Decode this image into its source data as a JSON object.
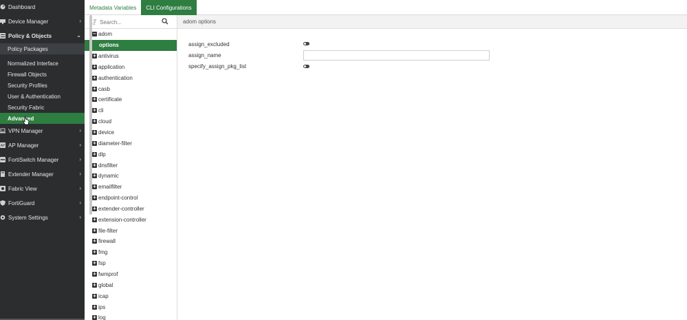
{
  "sidebar": {
    "items": [
      {
        "label": "Dashboard",
        "icon": "dashboard-icon",
        "chevron": false
      },
      {
        "label": "Device Manager",
        "icon": "device-manager-icon",
        "chevron": true
      },
      {
        "label": "Policy & Objects",
        "icon": "policy-objects-icon",
        "chevron": true,
        "expanded": true
      }
    ],
    "sub_items_a": [
      "Policy Packages"
    ],
    "sub_items_b": [
      "Normalized Interface",
      "Firewall Objects",
      "Security Profiles",
      "User & Authentication",
      "Security Fabric",
      "Advanced"
    ],
    "items_after": [
      {
        "label": "VPN Manager",
        "icon": "vpn-manager-icon"
      },
      {
        "label": "AP Manager",
        "icon": "ap-manager-icon"
      },
      {
        "label": "FortiSwitch Manager",
        "icon": "fortiswitch-manager-icon"
      },
      {
        "label": "Extender Manager",
        "icon": "extender-manager-icon"
      },
      {
        "label": "Fabric View",
        "icon": "fabric-view-icon"
      },
      {
        "label": "FortiGuard",
        "icon": "fortiguard-icon"
      },
      {
        "label": "System Settings",
        "icon": "system-settings-icon"
      }
    ]
  },
  "tabs": [
    {
      "label": "Metadata Variables",
      "active": false
    },
    {
      "label": "CLI Configurations",
      "active": true
    }
  ],
  "tree": {
    "search_placeholder": "Search...",
    "root": "adom",
    "selected": "options",
    "nodes": [
      "antivirus",
      "application",
      "authentication",
      "casb",
      "certificate",
      "cli",
      "cloud",
      "device",
      "diameter-filter",
      "dlp",
      "dnsfilter",
      "dynamic",
      "emailfilter",
      "endpoint-control",
      "extender-controller",
      "extension-controller",
      "file-filter",
      "firewall",
      "fmg",
      "fsp",
      "fwmprof",
      "global",
      "icap",
      "ips",
      "log"
    ]
  },
  "main": {
    "header": "adom options",
    "fields": [
      {
        "label": "assign_excluded",
        "type": "toggle",
        "value": false
      },
      {
        "label": "assign_name",
        "type": "text",
        "value": ""
      },
      {
        "label": "specify_assign_pkg_list",
        "type": "toggle",
        "value": false
      }
    ]
  },
  "colors": {
    "accent": "#2e7d41",
    "sidebar_bg": "#2b2d2f"
  }
}
